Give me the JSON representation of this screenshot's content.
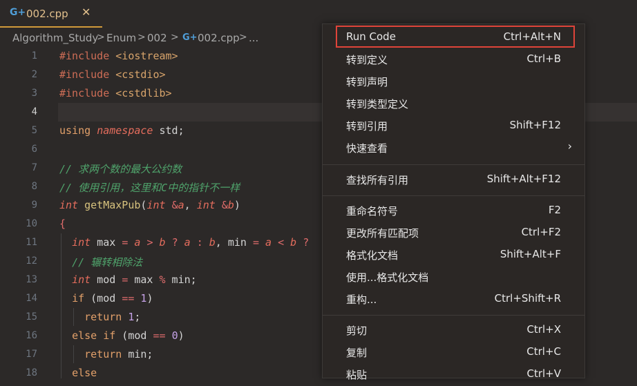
{
  "tab": {
    "icon": "cpp-file-icon",
    "glyph": "G+",
    "filename": "002.cpp",
    "close": "✕"
  },
  "breadcrumb": {
    "items": [
      "Algorithm_Study",
      "Enum",
      "002",
      "002.cpp",
      "..."
    ],
    "separator": ">",
    "file_glyph": "G+"
  },
  "editor": {
    "line_numbers": [
      "1",
      "2",
      "3",
      "4",
      "5",
      "6",
      "7",
      "8",
      "9",
      "10",
      "11",
      "12",
      "13",
      "14",
      "15",
      "16",
      "17",
      "18"
    ],
    "current_line": 4
  },
  "context_menu": {
    "items": [
      {
        "label": "Run Code",
        "shortcut": "Ctrl+Alt+N"
      },
      {
        "label": "转到定义",
        "shortcut": "Ctrl+B"
      },
      {
        "label": "转到声明",
        "shortcut": ""
      },
      {
        "label": "转到类型定义",
        "shortcut": ""
      },
      {
        "label": "转到引用",
        "shortcut": "Shift+F12"
      },
      {
        "label": "快速查看",
        "shortcut": ""
      },
      {
        "label": "查找所有引用",
        "shortcut": "Shift+Alt+F12"
      },
      {
        "label": "重命名符号",
        "shortcut": "F2"
      },
      {
        "label": "更改所有匹配项",
        "shortcut": "Ctrl+F2"
      },
      {
        "label": "格式化文档",
        "shortcut": "Shift+Alt+F"
      },
      {
        "label": "使用...格式化文档",
        "shortcut": ""
      },
      {
        "label": "重构...",
        "shortcut": "Ctrl+Shift+R"
      },
      {
        "label": "剪切",
        "shortcut": "Ctrl+X"
      },
      {
        "label": "复制",
        "shortcut": "Ctrl+C"
      },
      {
        "label": "粘贴",
        "shortcut": "Ctrl+V"
      }
    ],
    "submenu_arrow": "›",
    "highlight_color": "#e0443a"
  }
}
